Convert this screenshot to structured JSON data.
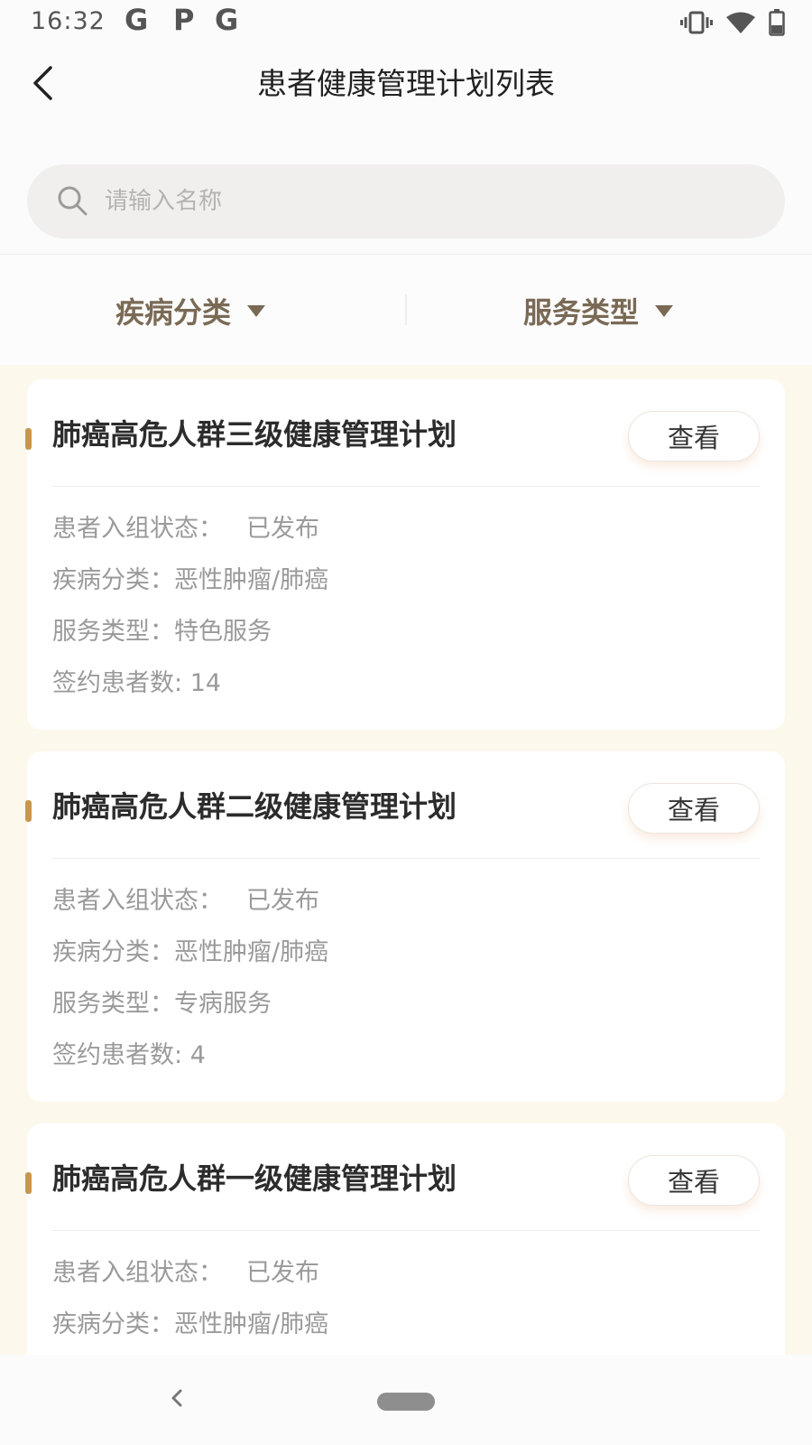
{
  "status_bar": {
    "time": "16:32",
    "notif_icons": [
      "G",
      "P",
      "G"
    ],
    "right_icons": [
      "vibrate-icon",
      "wifi-icon",
      "battery-icon"
    ]
  },
  "header": {
    "title": "患者健康管理计划列表",
    "back_icon": "chevron-left-icon"
  },
  "search": {
    "placeholder": "请输入名称",
    "value": ""
  },
  "filters": {
    "disease_label": "疾病分类",
    "service_label": "服务类型"
  },
  "labels": {
    "status": "患者入组状态：",
    "disease": "疾病分类：",
    "service": "服务类型：",
    "count": "签约患者数: "
  },
  "plans": [
    {
      "title": "肺癌高危人群三级健康管理计划",
      "action_label": "查看",
      "status": "已发布",
      "disease": "恶性肿瘤/肺癌",
      "service": "特色服务",
      "patients": "14"
    },
    {
      "title": "肺癌高危人群二级健康管理计划",
      "action_label": "查看",
      "status": "已发布",
      "disease": "恶性肿瘤/肺癌",
      "service": "专病服务",
      "patients": "4"
    },
    {
      "title": "肺癌高危人群一级健康管理计划",
      "action_label": "查看",
      "status": "已发布",
      "disease": "恶性肿瘤/肺癌"
    }
  ],
  "colors": {
    "accent": "#c9964d",
    "filter_text": "#7a6a55",
    "list_background": "#fdf8ec"
  }
}
